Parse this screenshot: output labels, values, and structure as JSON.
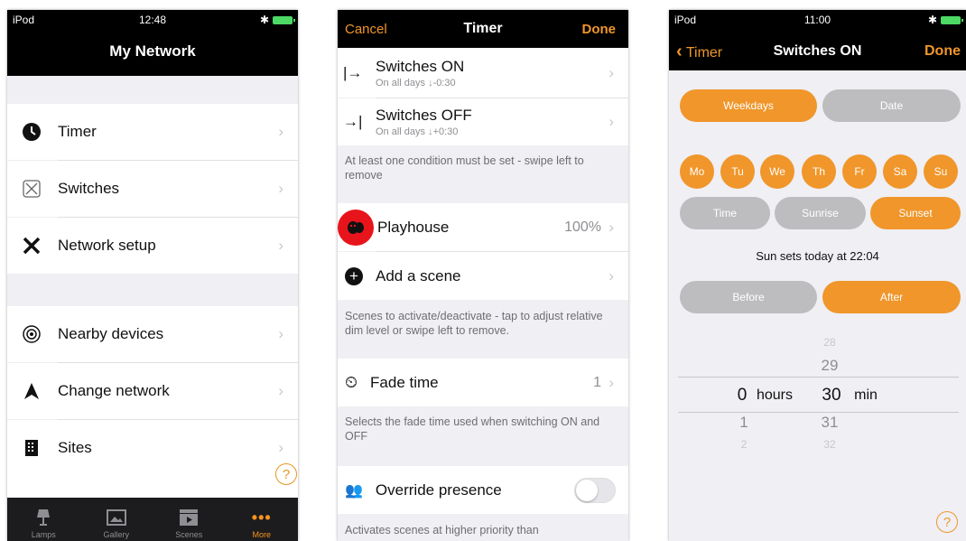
{
  "panel1": {
    "status": {
      "device": "iPod",
      "time": "12:48"
    },
    "title": "My Network",
    "rows": [
      {
        "icon": "clock-icon",
        "label": "Timer"
      },
      {
        "icon": "switch-icon",
        "label": "Switches"
      },
      {
        "icon": "tools-icon",
        "label": "Network setup"
      },
      {
        "icon": "broadcast-icon",
        "label": "Nearby devices"
      },
      {
        "icon": "navigation-arrow-icon",
        "label": "Change network"
      },
      {
        "icon": "building-icon",
        "label": "Sites"
      }
    ],
    "help": "?",
    "tabs": [
      {
        "icon": "lamp-icon",
        "label": "Lamps"
      },
      {
        "icon": "gallery-icon",
        "label": "Gallery"
      },
      {
        "icon": "scenes-icon",
        "label": "Scenes"
      },
      {
        "icon": "more-icon",
        "label": "More",
        "glyph": "•••"
      }
    ]
  },
  "panel2": {
    "nav": {
      "cancel": "Cancel",
      "title": "Timer",
      "done": "Done"
    },
    "conditions": [
      {
        "icon": "switch-on-arrow-icon",
        "glyph": "|→",
        "label": "Switches ON",
        "sub": "On all days ↓-0:30"
      },
      {
        "icon": "switch-off-arrow-icon",
        "glyph": "→|",
        "label": "Switches OFF",
        "sub": "On all days ↓+0:30"
      }
    ],
    "note1": "At least one condition must be set - swipe left to remove",
    "scene": {
      "label": "Playhouse",
      "value": "100%"
    },
    "add_scene": "Add a scene",
    "note2": "Scenes to activate/deactivate - tap to adjust relative dim level or swipe left to remove.",
    "fade": {
      "label": "Fade time",
      "value": "1"
    },
    "note3": "Selects the fade time used when switching ON and OFF",
    "override": {
      "label": "Override presence",
      "on": false
    },
    "note4": "Activates scenes at higher priority than"
  },
  "panel3": {
    "status": {
      "device": "iPod",
      "time": "11:00"
    },
    "nav": {
      "back": "Timer",
      "title": "Switches ON",
      "done": "Done"
    },
    "mode": {
      "options": [
        "Weekdays",
        "Date"
      ],
      "selected": "Weekdays"
    },
    "days": [
      "Mo",
      "Tu",
      "We",
      "Th",
      "Fr",
      "Sa",
      "Su"
    ],
    "event": {
      "options": [
        "Time",
        "Sunrise",
        "Sunset"
      ],
      "selected": "Sunset"
    },
    "sun_text": "Sun sets today at 22:04",
    "offset": {
      "options": [
        "Before",
        "After"
      ],
      "selected": "After"
    },
    "picker": {
      "hours_unit": "hours",
      "min_unit": "min",
      "hours": [
        "1",
        "2"
      ],
      "selected_hours": "0",
      "minutes": [
        "28",
        "29",
        "31",
        "32"
      ],
      "selected_min": "30"
    },
    "help": "?"
  }
}
